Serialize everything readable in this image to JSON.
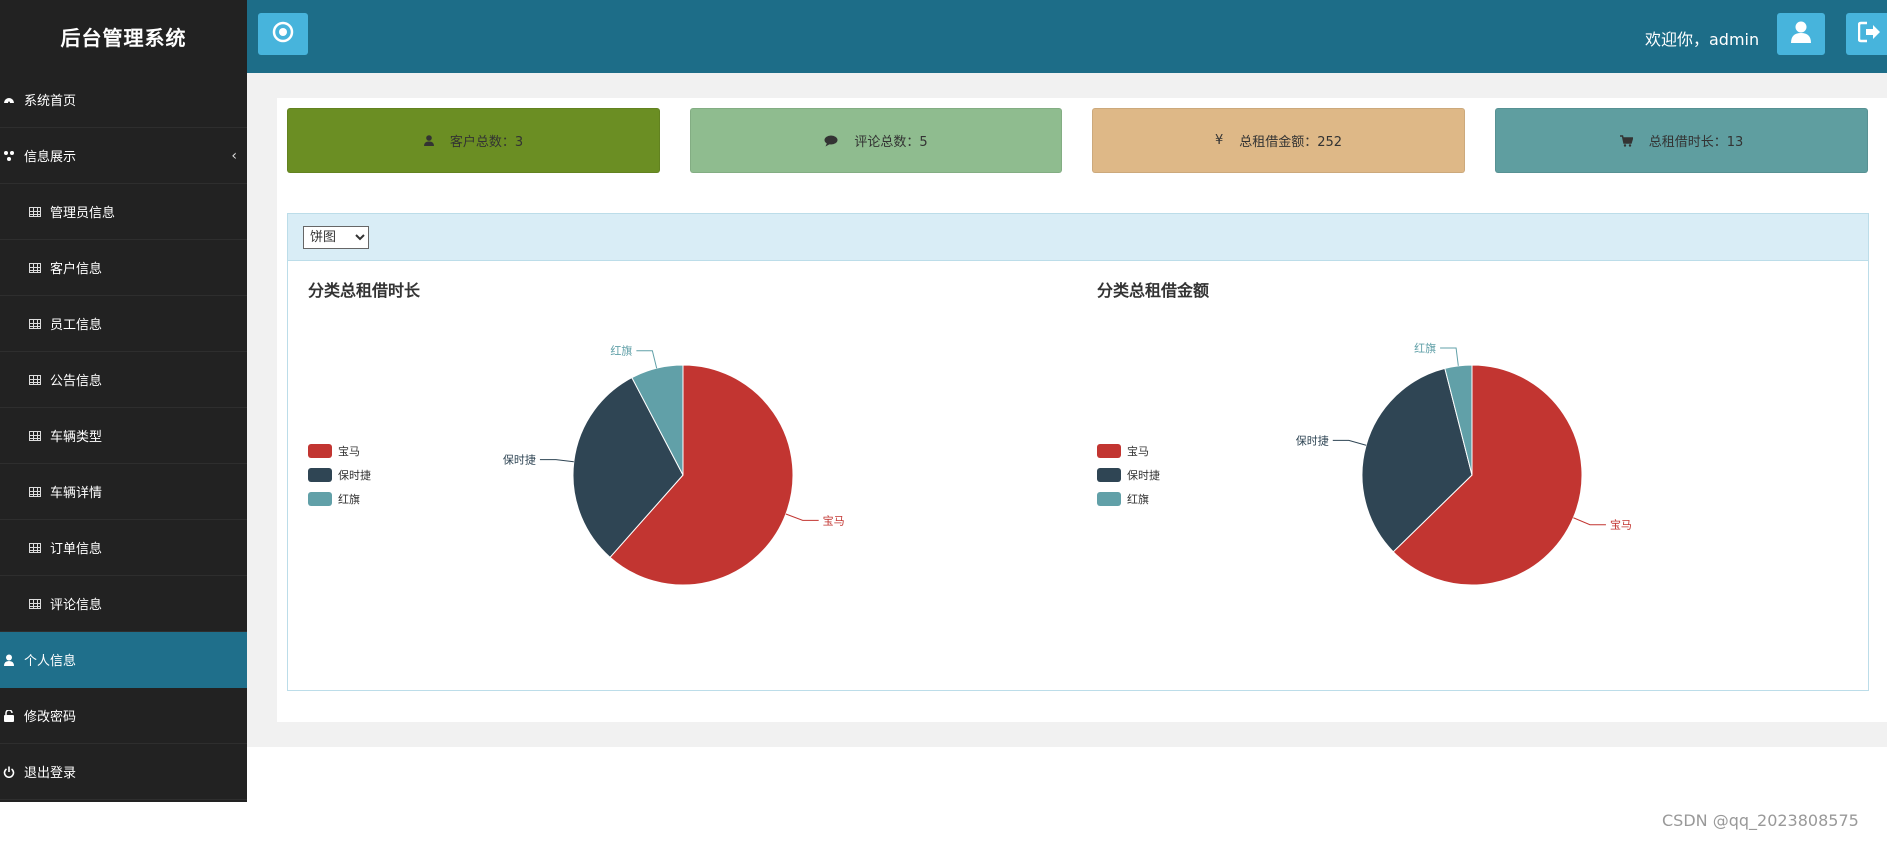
{
  "app": {
    "title": "后台管理系统"
  },
  "sidebar": {
    "items": [
      {
        "label": "系统首页",
        "icon": "dashboard-icon"
      },
      {
        "label": "信息展示",
        "icon": "cluster-icon",
        "expanded": true
      },
      {
        "label": "管理员信息",
        "icon": "table-icon"
      },
      {
        "label": "客户信息",
        "icon": "table-icon"
      },
      {
        "label": "员工信息",
        "icon": "table-icon"
      },
      {
        "label": "公告信息",
        "icon": "table-icon"
      },
      {
        "label": "车辆类型",
        "icon": "table-icon"
      },
      {
        "label": "车辆详情",
        "icon": "table-icon"
      },
      {
        "label": "订单信息",
        "icon": "table-icon"
      },
      {
        "label": "评论信息",
        "icon": "table-icon"
      },
      {
        "label": "个人信息",
        "icon": "user-icon",
        "active": true
      },
      {
        "label": "修改密码",
        "icon": "unlock-icon"
      },
      {
        "label": "退出登录",
        "icon": "power-icon"
      }
    ]
  },
  "header": {
    "welcome": "欢迎你，admin"
  },
  "stats": [
    {
      "label": "客户总数：3",
      "icon": "user-icon",
      "color": "#6b8e23"
    },
    {
      "label": "评论总数：5",
      "icon": "comment-icon",
      "color": "#8fbc8f"
    },
    {
      "label": "总租借金额：252",
      "icon": "yen-icon",
      "symbol": "¥",
      "color": "#deb887"
    },
    {
      "label": "总租借时长：13",
      "icon": "cart-icon",
      "color": "#5f9ea0"
    }
  ],
  "chart_panel": {
    "select_value": "饼图"
  },
  "chart_data": [
    {
      "type": "pie",
      "title": "分类总租借时长",
      "categories": [
        "宝马",
        "保时捷",
        "红旗"
      ],
      "values": [
        8,
        4,
        1
      ],
      "colors": [
        "#c23531",
        "#2f4554",
        "#61a0a8"
      ],
      "legend": "left"
    },
    {
      "type": "pie",
      "title": "分类总租借金额",
      "categories": [
        "宝马",
        "保时捷",
        "红旗"
      ],
      "values": [
        158,
        84,
        10
      ],
      "colors": [
        "#c23531",
        "#2f4554",
        "#61a0a8"
      ],
      "legend": "left"
    }
  ],
  "watermark": "CSDN @qq_2023808575"
}
